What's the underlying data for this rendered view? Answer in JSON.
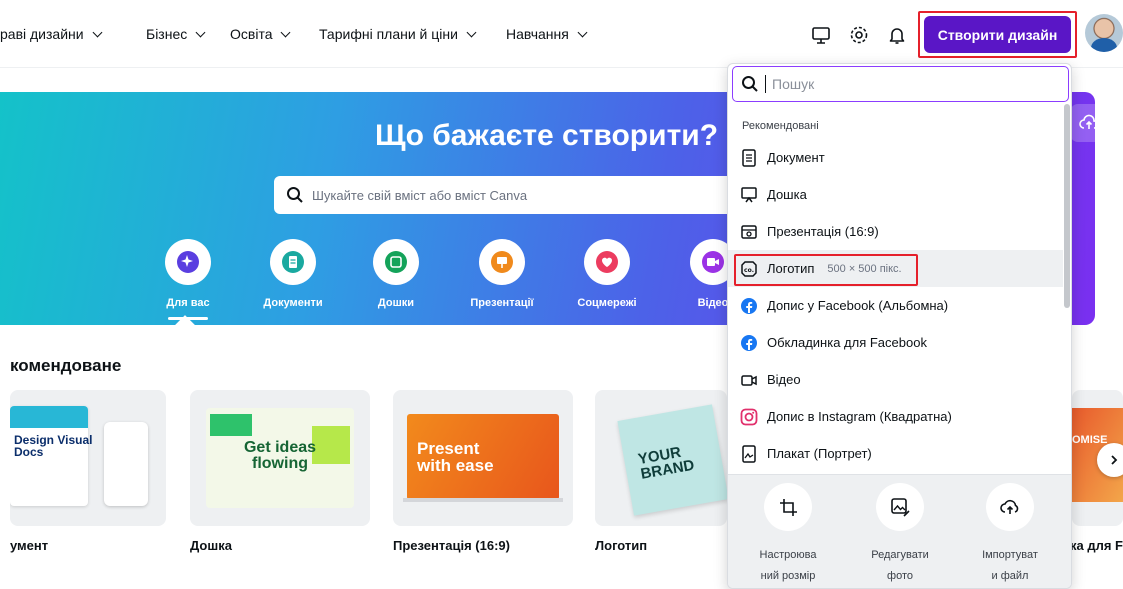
{
  "nav": {
    "items": [
      "раві дизайни",
      "Бізнес",
      "Освіта",
      "Тарифні плани й ціни",
      "Навчання"
    ],
    "create_label": "Створити дизайн"
  },
  "hero": {
    "title": "Що бажаєте створити?",
    "search_placeholder": "Шукайте свій вміст або вміст Canva",
    "categories": [
      {
        "label": "Для вас",
        "icon": "sparkle-icon",
        "color": "#5a3ee0"
      },
      {
        "label": "Документи",
        "icon": "document-icon",
        "color": "#1aa9a0"
      },
      {
        "label": "Дошки",
        "icon": "whiteboard-icon",
        "color": "#14a35a"
      },
      {
        "label": "Презентації",
        "icon": "presentation-icon",
        "color": "#f08a1c"
      },
      {
        "label": "Соцмережі",
        "icon": "heart-icon",
        "color": "#ec3c5f"
      },
      {
        "label": "Відео",
        "icon": "video-icon",
        "color": "#9b32e6"
      }
    ]
  },
  "recommended": {
    "title": "комендоване",
    "cards": [
      {
        "label": "умент",
        "text": "Design Visual Docs"
      },
      {
        "label": "Дошка",
        "text": "Get ideas flowing"
      },
      {
        "label": "Презентація (16:9)",
        "text": "Present with ease"
      },
      {
        "label": "Логотип",
        "text": "YOUR BRAND"
      },
      {
        "label": "ка для Fa",
        "text": "OMISE"
      }
    ]
  },
  "dropdown": {
    "search_placeholder": "Пошук",
    "section": "Рекомендовані",
    "items": [
      {
        "label": "Документ",
        "icon": "document-icon",
        "sub": ""
      },
      {
        "label": "Дошка",
        "icon": "whiteboard-icon",
        "sub": ""
      },
      {
        "label": "Презентація (16:9)",
        "icon": "presentation-icon",
        "sub": ""
      },
      {
        "label": "Логотип",
        "icon": "logo-icon",
        "sub": "500 × 500 пікс."
      },
      {
        "label": "Допис у Facebook (Альбомна)",
        "icon": "facebook-icon",
        "sub": ""
      },
      {
        "label": "Обкладинка для Facebook",
        "icon": "facebook-icon",
        "sub": ""
      },
      {
        "label": "Відео",
        "icon": "video-icon",
        "sub": ""
      },
      {
        "label": "Допис в Instagram (Квадратна)",
        "icon": "instagram-icon",
        "sub": ""
      },
      {
        "label": "Плакат (Портрет)",
        "icon": "poster-icon",
        "sub": ""
      }
    ],
    "footer": [
      {
        "label": "Настроюва\nний розмір",
        "icon": "custom-size-icon"
      },
      {
        "label": "Редагувати\nфото",
        "icon": "edit-photo-icon"
      },
      {
        "label": "Імпортуват\nи файл",
        "icon": "upload-icon"
      }
    ]
  },
  "colors": {
    "accent": "#5a16c6",
    "highlight": "#e5202b",
    "search_border": "#8b3dff"
  }
}
